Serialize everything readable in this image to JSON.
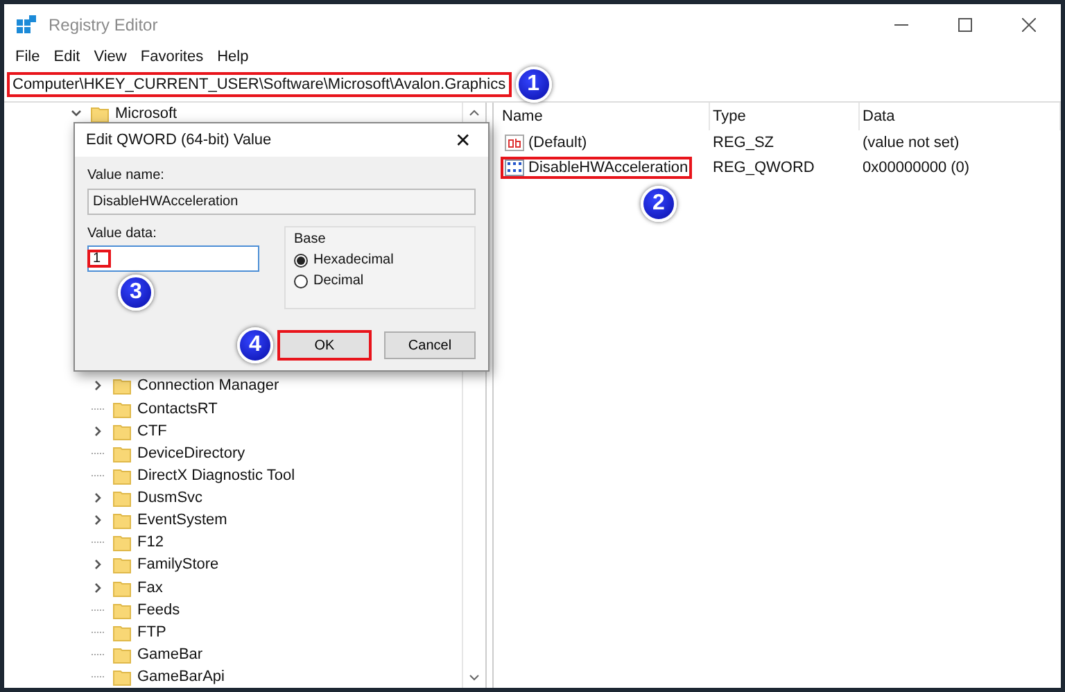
{
  "window": {
    "title": "Registry Editor"
  },
  "menu": [
    "File",
    "Edit",
    "View",
    "Favorites",
    "Help"
  ],
  "address_bar": {
    "value": "Computer\\HKEY_CURRENT_USER\\Software\\Microsoft\\Avalon.Graphics",
    "highlighted": true,
    "step": "1"
  },
  "tree": {
    "items": [
      {
        "label": "Microsoft",
        "has_children": true,
        "expanded": true,
        "children": [
          {
            "label": "Connection Manager",
            "has_children": true,
            "expanded": false
          },
          {
            "label": "ContactsRT",
            "has_children": false,
            "expanded": false
          },
          {
            "label": "CTF",
            "has_children": true,
            "expanded": false
          },
          {
            "label": "DeviceDirectory",
            "has_children": false,
            "expanded": false
          },
          {
            "label": "DirectX Diagnostic Tool",
            "has_children": false,
            "expanded": false
          },
          {
            "label": "DusmSvc",
            "has_children": true,
            "expanded": false
          },
          {
            "label": "EventSystem",
            "has_children": true,
            "expanded": false
          },
          {
            "label": "F12",
            "has_children": false,
            "expanded": false
          },
          {
            "label": "FamilyStore",
            "has_children": true,
            "expanded": false
          },
          {
            "label": "Fax",
            "has_children": true,
            "expanded": false
          },
          {
            "label": "Feeds",
            "has_children": false,
            "expanded": false
          },
          {
            "label": "FTP",
            "has_children": false,
            "expanded": false
          },
          {
            "label": "GameBar",
            "has_children": false,
            "expanded": false
          },
          {
            "label": "GameBarApi",
            "has_children": false,
            "expanded": false
          }
        ]
      }
    ]
  },
  "values_table": {
    "columns": [
      "Name",
      "Type",
      "Data"
    ],
    "rows": [
      {
        "kind": "string",
        "name": "(Default)",
        "type": "REG_SZ",
        "data": "(value not set)",
        "highlighted": false
      },
      {
        "kind": "binary",
        "name": "DisableHWAcceleration",
        "type": "REG_QWORD",
        "data": "0x00000000 (0)",
        "highlighted": true,
        "step": "2"
      }
    ]
  },
  "dialog": {
    "title": "Edit QWORD (64-bit) Value",
    "close": "✕",
    "value_name": {
      "label": "Value name:",
      "value": "DisableHWAcceleration"
    },
    "value_data": {
      "label": "Value data:",
      "value": "1",
      "highlighted": true,
      "step": "3"
    },
    "base": {
      "label": "Base",
      "options": [
        {
          "label": "Hexadecimal",
          "selected": true
        },
        {
          "label": "Decimal",
          "selected": false
        }
      ]
    },
    "buttons": [
      {
        "label": "OK",
        "highlighted": true,
        "step": "4"
      },
      {
        "label": "Cancel",
        "highlighted": false
      }
    ]
  }
}
